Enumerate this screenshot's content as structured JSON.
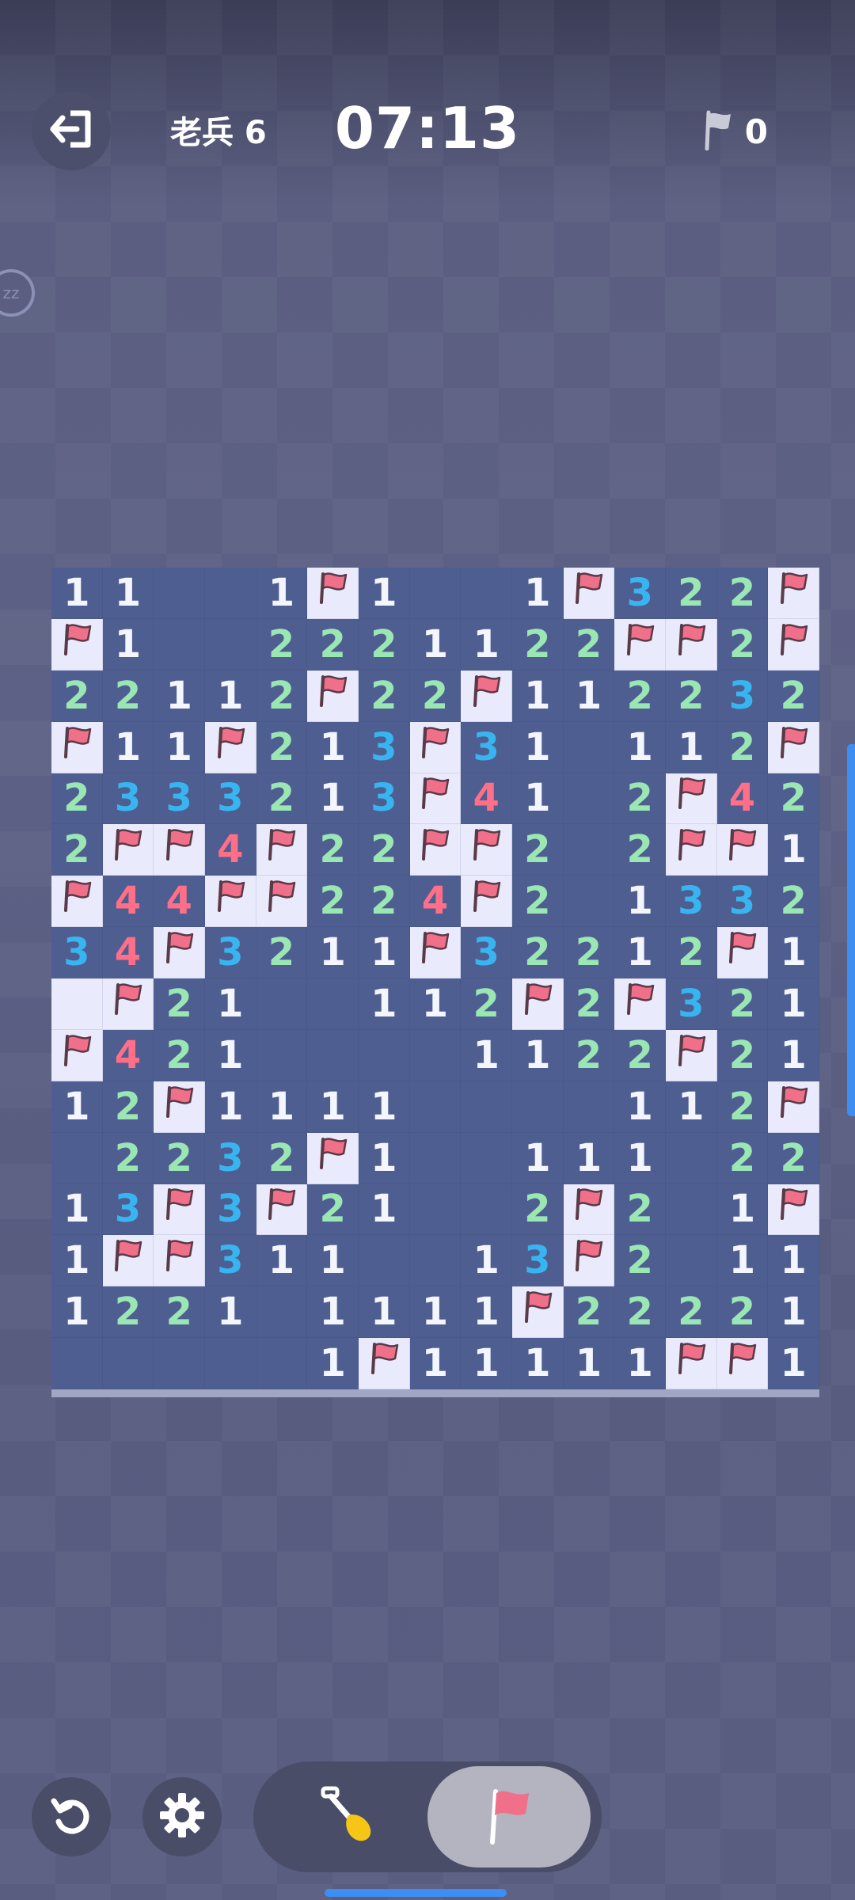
{
  "header": {
    "level_label": "老兵 6",
    "timer": "07:13",
    "flag_count": "0",
    "side_badge": "zz"
  },
  "board": {
    "rows": 16,
    "cols": 15,
    "grid": [
      [
        "1",
        "1",
        "",
        "",
        "1",
        "F",
        "1",
        "",
        "",
        "1",
        "F",
        "3",
        "2",
        "2",
        "F"
      ],
      [
        "F",
        "1",
        "",
        "",
        "2",
        "2",
        "2",
        "1",
        "1",
        "2",
        "2",
        "F",
        "F",
        "2",
        "F"
      ],
      [
        "2",
        "2",
        "1",
        "1",
        "2",
        "F",
        "2",
        "2",
        "F",
        "1",
        "1",
        "2",
        "2",
        "3",
        "2"
      ],
      [
        "F",
        "1",
        "1",
        "F",
        "2",
        "1",
        "3",
        "F",
        "3",
        "1",
        "",
        "1",
        "1",
        "2",
        "F"
      ],
      [
        "2",
        "3",
        "3",
        "3",
        "2",
        "1",
        "3",
        "F",
        "4",
        "1",
        "",
        "2",
        "F",
        "4",
        "2"
      ],
      [
        "2",
        "F",
        "F",
        "4",
        "F",
        "2",
        "2",
        "F",
        "F",
        "2",
        "",
        "2",
        "F",
        "F",
        "1"
      ],
      [
        "F",
        "4",
        "4",
        "F",
        "F",
        "2",
        "2",
        "4",
        "F",
        "2",
        "",
        "1",
        "3",
        "3",
        "2"
      ],
      [
        "3",
        "4",
        "F",
        "3",
        "2",
        "1",
        "1",
        "F",
        "3",
        "2",
        "2",
        "1",
        "2",
        "F",
        "1"
      ],
      [
        "H",
        "F",
        "2",
        "1",
        "",
        "",
        "1",
        "1",
        "2",
        "F",
        "2",
        "F",
        "3",
        "2",
        "1"
      ],
      [
        "F",
        "4",
        "2",
        "1",
        "",
        "",
        "",
        "",
        "1",
        "1",
        "2",
        "2",
        "F",
        "2",
        "1"
      ],
      [
        "1",
        "2",
        "F",
        "1",
        "1",
        "1",
        "1",
        "",
        "",
        "",
        "",
        "1",
        "1",
        "2",
        "F"
      ],
      [
        "",
        "2",
        "2",
        "3",
        "2",
        "F",
        "1",
        "",
        "",
        "1",
        "1",
        "1",
        "",
        "2",
        "2"
      ],
      [
        "1",
        "3",
        "F",
        "3",
        "F",
        "2",
        "1",
        "",
        "",
        "2",
        "F",
        "2",
        "",
        "1",
        "F"
      ],
      [
        "1",
        "F",
        "F",
        "3",
        "1",
        "1",
        "",
        "",
        "1",
        "3",
        "F",
        "2",
        "",
        "1",
        "1"
      ],
      [
        "1",
        "2",
        "2",
        "1",
        "",
        "1",
        "1",
        "1",
        "1",
        "F",
        "2",
        "2",
        "2",
        "2",
        "1"
      ],
      [
        "",
        "",
        "",
        "",
        "",
        "1",
        "F",
        "1",
        "1",
        "1",
        "1",
        "1",
        "F",
        "F",
        "1"
      ]
    ]
  },
  "colors": {
    "revealed_cell": "#4f5e90",
    "hidden_cell": "#e9eafb",
    "n1": "#f3f5ff",
    "n2": "#9ae7b4",
    "n3": "#38b5f0",
    "n4": "#ff6f88",
    "flag": "#f0708a",
    "accent": "#3d8ef2"
  },
  "icons": {
    "exit": "exit-icon",
    "flag_counter": "flag-outline-icon",
    "undo": "undo-icon",
    "settings": "gear-icon",
    "dig": "shovel-icon",
    "flag_mode": "flag-icon"
  },
  "controls": {
    "mode_selected": "flag"
  }
}
